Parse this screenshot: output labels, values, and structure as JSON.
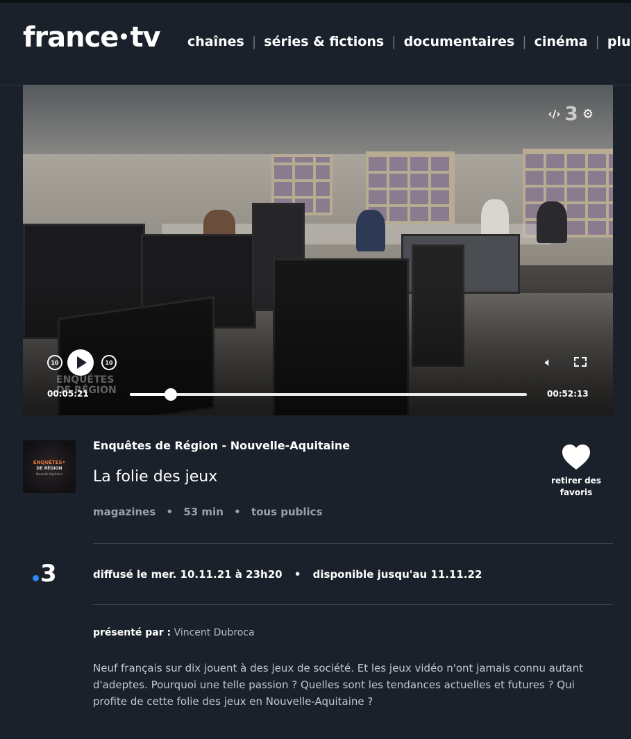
{
  "header": {
    "logo_left": "france",
    "logo_right": "tv",
    "nav": [
      {
        "label": "chaînes"
      },
      {
        "label": "séries & fictions"
      },
      {
        "label": "documentaires"
      },
      {
        "label": "cinéma"
      },
      {
        "label": "plus"
      }
    ]
  },
  "player": {
    "embed_label": "‹/›",
    "channel_mark": "3",
    "rewind_label": "10",
    "forward_label": "10",
    "watermark_line1": "ENQUÊTES",
    "watermark_line2": "DE RÉGION",
    "current_time": "00:05:21",
    "duration": "00:52:13",
    "progress_fraction": 0.1025
  },
  "program": {
    "thumb_line1": "ENQUÊTES•",
    "thumb_line2": "DE RÉGION",
    "thumb_line3": "Nouvelle-Aquitaine",
    "title": "Enquêtes de Région - Nouvelle-Aquitaine",
    "episode": "La folie des jeux",
    "genre": "magazines",
    "length": "53 min",
    "rating": "tous publics",
    "meta_sep": "•"
  },
  "favorite": {
    "label_line1": "retirer des",
    "label_line2": "favoris"
  },
  "broadcast": {
    "channel": "3",
    "aired": "diffusé le mer. 10.11.21 à 23h20",
    "available": "disponible jusqu'au 11.11.22",
    "sep": "•"
  },
  "presenter": {
    "label": "présenté par :",
    "name": "Vincent Dubroca"
  },
  "description": "Neuf français sur dix jouent à des jeux de société. Et les jeux vidéo n'ont jamais connu autant d'adeptes. Pourquoi une telle passion ? Quelles sont les tendances actuelles et futures ? Qui profite de cette folie des jeux en Nouvelle-Aquitaine ?"
}
